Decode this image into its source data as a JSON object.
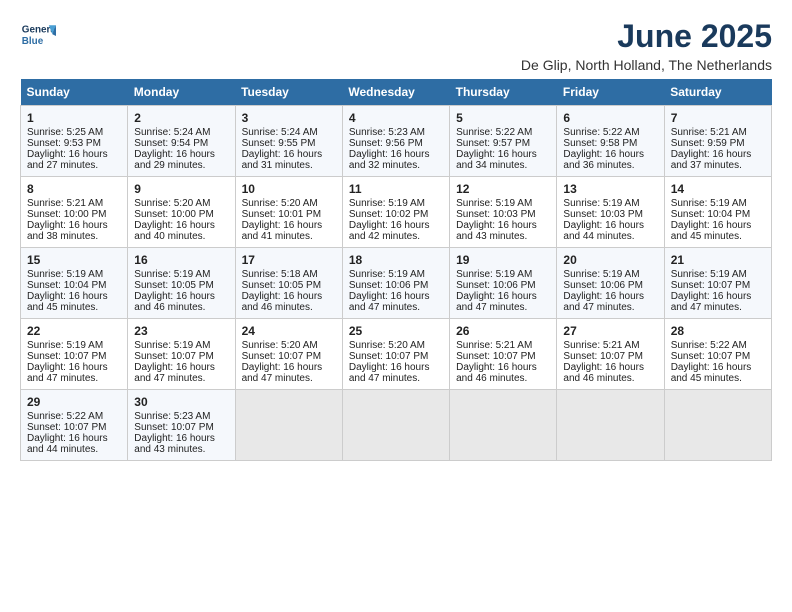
{
  "logo": {
    "line1": "General",
    "line2": "Blue"
  },
  "title": "June 2025",
  "subtitle": "De Glip, North Holland, The Netherlands",
  "days_header": [
    "Sunday",
    "Monday",
    "Tuesday",
    "Wednesday",
    "Thursday",
    "Friday",
    "Saturday"
  ],
  "weeks": [
    [
      {
        "day": "1",
        "info": "Sunrise: 5:25 AM\nSunset: 9:53 PM\nDaylight: 16 hours\nand 27 minutes."
      },
      {
        "day": "2",
        "info": "Sunrise: 5:24 AM\nSunset: 9:54 PM\nDaylight: 16 hours\nand 29 minutes."
      },
      {
        "day": "3",
        "info": "Sunrise: 5:24 AM\nSunset: 9:55 PM\nDaylight: 16 hours\nand 31 minutes."
      },
      {
        "day": "4",
        "info": "Sunrise: 5:23 AM\nSunset: 9:56 PM\nDaylight: 16 hours\nand 32 minutes."
      },
      {
        "day": "5",
        "info": "Sunrise: 5:22 AM\nSunset: 9:57 PM\nDaylight: 16 hours\nand 34 minutes."
      },
      {
        "day": "6",
        "info": "Sunrise: 5:22 AM\nSunset: 9:58 PM\nDaylight: 16 hours\nand 36 minutes."
      },
      {
        "day": "7",
        "info": "Sunrise: 5:21 AM\nSunset: 9:59 PM\nDaylight: 16 hours\nand 37 minutes."
      }
    ],
    [
      {
        "day": "8",
        "info": "Sunrise: 5:21 AM\nSunset: 10:00 PM\nDaylight: 16 hours\nand 38 minutes."
      },
      {
        "day": "9",
        "info": "Sunrise: 5:20 AM\nSunset: 10:00 PM\nDaylight: 16 hours\nand 40 minutes."
      },
      {
        "day": "10",
        "info": "Sunrise: 5:20 AM\nSunset: 10:01 PM\nDaylight: 16 hours\nand 41 minutes."
      },
      {
        "day": "11",
        "info": "Sunrise: 5:19 AM\nSunset: 10:02 PM\nDaylight: 16 hours\nand 42 minutes."
      },
      {
        "day": "12",
        "info": "Sunrise: 5:19 AM\nSunset: 10:03 PM\nDaylight: 16 hours\nand 43 minutes."
      },
      {
        "day": "13",
        "info": "Sunrise: 5:19 AM\nSunset: 10:03 PM\nDaylight: 16 hours\nand 44 minutes."
      },
      {
        "day": "14",
        "info": "Sunrise: 5:19 AM\nSunset: 10:04 PM\nDaylight: 16 hours\nand 45 minutes."
      }
    ],
    [
      {
        "day": "15",
        "info": "Sunrise: 5:19 AM\nSunset: 10:04 PM\nDaylight: 16 hours\nand 45 minutes."
      },
      {
        "day": "16",
        "info": "Sunrise: 5:19 AM\nSunset: 10:05 PM\nDaylight: 16 hours\nand 46 minutes."
      },
      {
        "day": "17",
        "info": "Sunrise: 5:18 AM\nSunset: 10:05 PM\nDaylight: 16 hours\nand 46 minutes."
      },
      {
        "day": "18",
        "info": "Sunrise: 5:19 AM\nSunset: 10:06 PM\nDaylight: 16 hours\nand 47 minutes."
      },
      {
        "day": "19",
        "info": "Sunrise: 5:19 AM\nSunset: 10:06 PM\nDaylight: 16 hours\nand 47 minutes."
      },
      {
        "day": "20",
        "info": "Sunrise: 5:19 AM\nSunset: 10:06 PM\nDaylight: 16 hours\nand 47 minutes."
      },
      {
        "day": "21",
        "info": "Sunrise: 5:19 AM\nSunset: 10:07 PM\nDaylight: 16 hours\nand 47 minutes."
      }
    ],
    [
      {
        "day": "22",
        "info": "Sunrise: 5:19 AM\nSunset: 10:07 PM\nDaylight: 16 hours\nand 47 minutes."
      },
      {
        "day": "23",
        "info": "Sunrise: 5:19 AM\nSunset: 10:07 PM\nDaylight: 16 hours\nand 47 minutes."
      },
      {
        "day": "24",
        "info": "Sunrise: 5:20 AM\nSunset: 10:07 PM\nDaylight: 16 hours\nand 47 minutes."
      },
      {
        "day": "25",
        "info": "Sunrise: 5:20 AM\nSunset: 10:07 PM\nDaylight: 16 hours\nand 47 minutes."
      },
      {
        "day": "26",
        "info": "Sunrise: 5:21 AM\nSunset: 10:07 PM\nDaylight: 16 hours\nand 46 minutes."
      },
      {
        "day": "27",
        "info": "Sunrise: 5:21 AM\nSunset: 10:07 PM\nDaylight: 16 hours\nand 46 minutes."
      },
      {
        "day": "28",
        "info": "Sunrise: 5:22 AM\nSunset: 10:07 PM\nDaylight: 16 hours\nand 45 minutes."
      }
    ],
    [
      {
        "day": "29",
        "info": "Sunrise: 5:22 AM\nSunset: 10:07 PM\nDaylight: 16 hours\nand 44 minutes."
      },
      {
        "day": "30",
        "info": "Sunrise: 5:23 AM\nSunset: 10:07 PM\nDaylight: 16 hours\nand 43 minutes."
      },
      {
        "day": "",
        "info": ""
      },
      {
        "day": "",
        "info": ""
      },
      {
        "day": "",
        "info": ""
      },
      {
        "day": "",
        "info": ""
      },
      {
        "day": "",
        "info": ""
      }
    ]
  ]
}
